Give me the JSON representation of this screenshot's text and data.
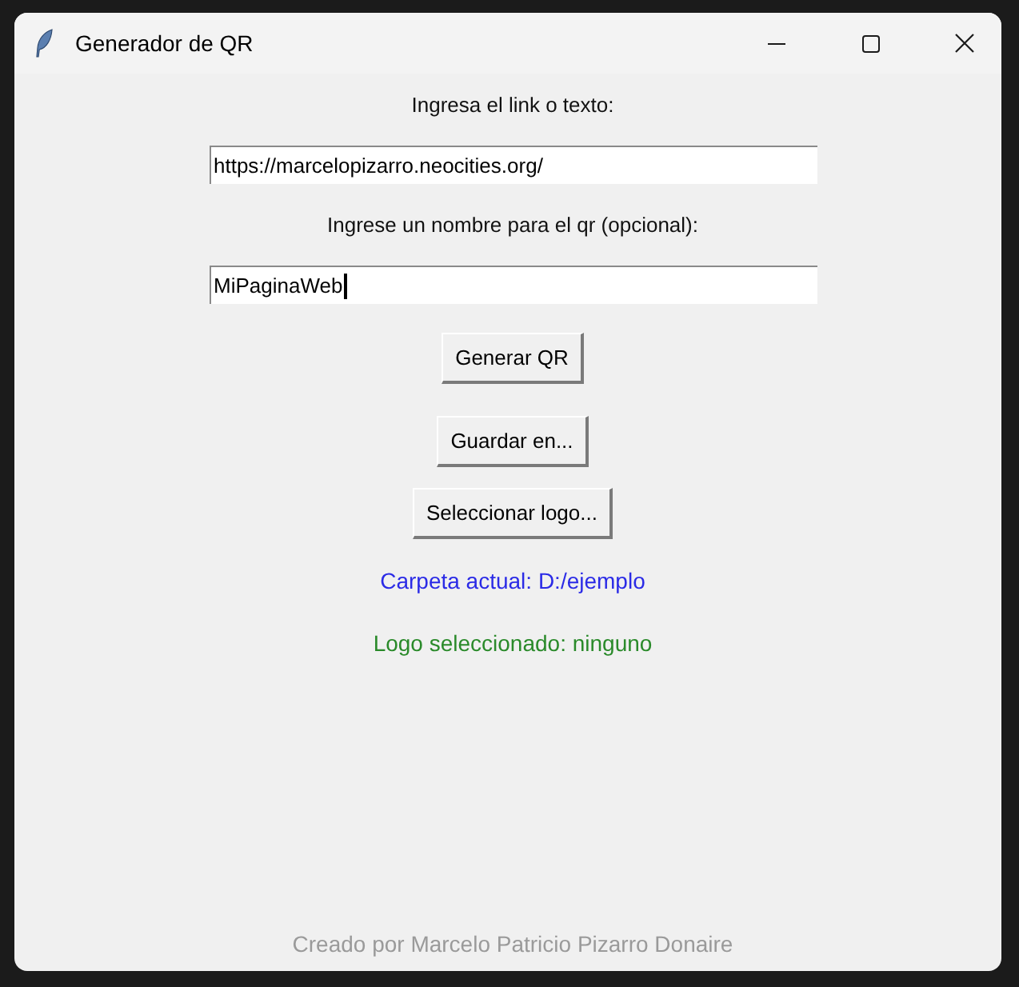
{
  "window": {
    "title": "Generador de QR"
  },
  "fields": [
    {
      "label": "Ingresa el link o texto:",
      "value": "https://marcelopizarro.neocities.org/",
      "focused": false
    },
    {
      "label": "Ingrese un nombre para el qr (opcional):",
      "value": "MiPaginaWeb",
      "focused": true
    }
  ],
  "buttons": [
    "Generar QR",
    "Guardar en...",
    "Seleccionar logo..."
  ],
  "status": [
    {
      "text": "Carpeta actual: D:/ejemplo",
      "color": "#2b2be6"
    },
    {
      "text": "Logo seleccionado: ninguno",
      "color": "#2a8a2a"
    }
  ],
  "footer": "Creado por Marcelo Patricio Pizarro Donaire"
}
